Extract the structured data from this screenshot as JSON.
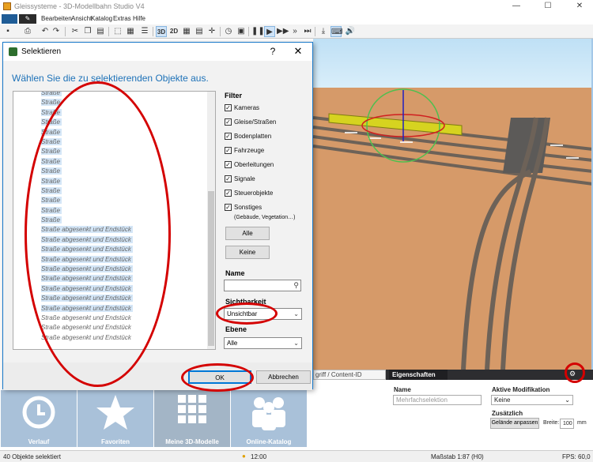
{
  "app": {
    "title": "Gleissysteme - 3D-Modellbahn Studio V4",
    "window_controls": {
      "minimize": "—",
      "maximize": "☐",
      "close": "✕"
    }
  },
  "menu": {
    "edit_glyph": "✎",
    "items": [
      "Bearbeiten",
      "Ansicht",
      "Katalog",
      "Extras",
      "Hilfe"
    ]
  },
  "toolbar": {
    "view_3d": "3D",
    "view_2d": "2D"
  },
  "dialog": {
    "title": "Selektieren",
    "help": "?",
    "close": "✕",
    "heading": "Wählen Sie die zu selektierenden Objekte aus.",
    "list": [
      {
        "label": "Straße",
        "highlight": true
      },
      {
        "label": "Straße",
        "highlight": true
      },
      {
        "label": "Straße",
        "highlight": true
      },
      {
        "label": "Straße",
        "highlight": true
      },
      {
        "label": "Straße",
        "highlight": true
      },
      {
        "label": "Straße",
        "highlight": true
      },
      {
        "label": "Straße",
        "highlight": true
      },
      {
        "label": "Straße",
        "highlight": true
      },
      {
        "label": "Straße",
        "highlight": true
      },
      {
        "label": "Straße",
        "highlight": true
      },
      {
        "label": "Straße",
        "highlight": true
      },
      {
        "label": "Straße",
        "highlight": true
      },
      {
        "label": "Straße",
        "highlight": true
      },
      {
        "label": "Straße",
        "highlight": true
      },
      {
        "label": "Straße abgesenkt und Endstück",
        "highlight": true
      },
      {
        "label": "Straße abgesenkt und Endstück",
        "highlight": true
      },
      {
        "label": "Straße abgesenkt und Endstück",
        "highlight": true
      },
      {
        "label": "Straße abgesenkt und Endstück",
        "highlight": true
      },
      {
        "label": "Straße abgesenkt und Endstück",
        "highlight": true
      },
      {
        "label": "Straße abgesenkt und Endstück",
        "highlight": true
      },
      {
        "label": "Straße abgesenkt und Endstück",
        "highlight": true
      },
      {
        "label": "Straße abgesenkt und Endstück",
        "highlight": true
      },
      {
        "label": "Straße abgesenkt und Endstück",
        "highlight": true
      },
      {
        "label": "Straße abgesenkt und Endstück",
        "highlight": false
      },
      {
        "label": "Straße abgesenkt und Endstück",
        "highlight": false
      },
      {
        "label": "Straße abgesenkt und Endstück",
        "highlight": false
      }
    ],
    "filter": {
      "title": "Filter",
      "items": [
        {
          "label": "Kameras",
          "checked": true
        },
        {
          "label": "Gleise/Straßen",
          "checked": true
        },
        {
          "label": "Bodenplatten",
          "checked": true
        },
        {
          "label": "Fahrzeuge",
          "checked": true
        },
        {
          "label": "Oberleitungen",
          "checked": true
        },
        {
          "label": "Signale",
          "checked": true
        },
        {
          "label": "Steuerobjekte",
          "checked": true
        },
        {
          "label": "Sonstiges",
          "checked": true
        }
      ],
      "sonstiges_note": "(Gebäude, Vegetation…)",
      "all_button": "Alle",
      "none_button": "Keine"
    },
    "name_label": "Name",
    "name_value": "",
    "search_glyph": "⚲",
    "visibility_label": "Sichtbarkeit",
    "visibility_value": "Unsichtbar",
    "layer_label": "Ebene",
    "layer_value": "Alle",
    "ok_button": "OK",
    "cancel_button": "Abbrechen",
    "dropdown_arrow": "⌄"
  },
  "panel": {
    "content_id_field": "griff / Content-ID",
    "properties_tab": "Eigenschaften"
  },
  "catalog": {
    "tiles": [
      {
        "label": "Verlauf",
        "icon": "clock-icon"
      },
      {
        "label": "Favoriten",
        "icon": "star-icon"
      },
      {
        "label": "Meine 3D-Modelle",
        "icon": "grid-icon"
      },
      {
        "label": "Online-Katalog",
        "icon": "people-icon"
      }
    ]
  },
  "properties": {
    "name_label": "Name",
    "name_placeholder": "Mehrfachselektion",
    "active_mod_label": "Aktive Modifikation",
    "active_mod_value": "Keine",
    "extra_label": "Zusätzlich",
    "terrain_button": "Gelände anpassen",
    "width_label": "Breite:",
    "width_value": "100",
    "width_unit": "mm"
  },
  "status": {
    "selection": "40 Objekte selektiert",
    "time": "12:00",
    "scale": "Maßstab 1:87 (H0)",
    "fps": "FPS: 60,0"
  },
  "colors": {
    "accent": "#1e72b8",
    "annotation": "#d40000",
    "tile_bg": "#a9c1d9",
    "ground": "#d89c6c"
  }
}
